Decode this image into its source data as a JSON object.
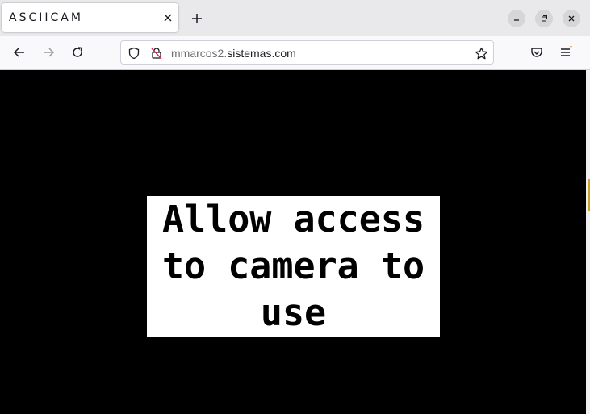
{
  "browser": {
    "tab_title": "ASCIICAM",
    "url_prefix": "mmarcos2.",
    "url_domain": "sistemas.com"
  },
  "page": {
    "message_line1": "Allow access",
    "message_line2": "to camera to",
    "message_line3": "use"
  },
  "colors": {
    "content_background": "#000000",
    "message_background": "#ffffff",
    "accent": "#e8a23a"
  },
  "icons": [
    "close-icon",
    "plus-icon",
    "minimize-icon",
    "restore-icon",
    "close-icon",
    "back-arrow-icon",
    "forward-arrow-icon",
    "reload-icon",
    "shield-icon",
    "insecure-lock-icon",
    "star-icon",
    "pocket-icon",
    "menu-icon"
  ]
}
